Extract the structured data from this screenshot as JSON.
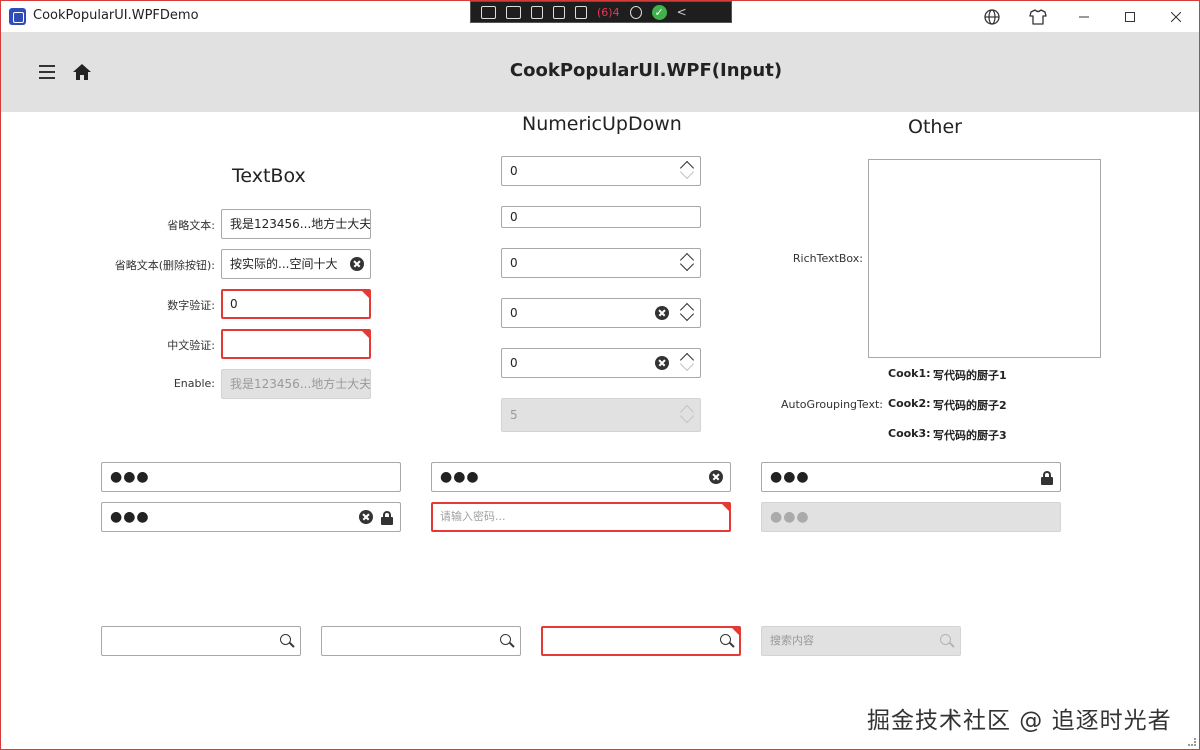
{
  "window": {
    "title": "CookPopularUI.WPFDemo"
  },
  "debug_toolbar": {
    "counter": "(6)4",
    "ok_glyph": "✓",
    "collapse_glyph": "<"
  },
  "header": {
    "title": "CookPopularUI.WPF(Input)"
  },
  "textbox_section": {
    "title": "TextBox",
    "rows": [
      {
        "label": "省略文本:",
        "value": "我是123456...地方士大夫"
      },
      {
        "label": "省略文本(删除按钮):",
        "value": "按实际的...空间十大"
      },
      {
        "label": "数字验证:",
        "value": "0"
      },
      {
        "label": "中文验证:",
        "value": ""
      },
      {
        "label": "Enable:",
        "value": "我是123456...地方士大夫"
      }
    ]
  },
  "numeric_section": {
    "title": "NumericUpDown",
    "values": [
      "0",
      "0",
      "0",
      "0",
      "0",
      "5"
    ]
  },
  "other_section": {
    "title": "Other",
    "richtext_label": "RichTextBox:",
    "grouping_label": "AutoGroupingText:",
    "grouping_items": [
      {
        "key": "Cook1:",
        "value": "写代码的厨子1"
      },
      {
        "key": "Cook2:",
        "value": "写代码的厨子2"
      },
      {
        "key": "Cook3:",
        "value": "写代码的厨子3"
      }
    ]
  },
  "password_boxes": {
    "masked": "●●●",
    "placeholder": "请输入密码..."
  },
  "search_boxes": {
    "placeholder": "搜索内容"
  },
  "watermark": "掘金技术社区 @ 追逐时光者"
}
